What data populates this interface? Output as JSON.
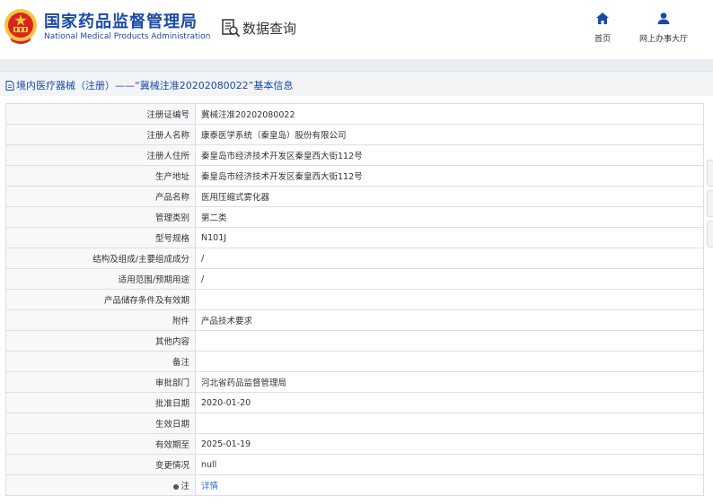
{
  "header": {
    "org_name_cn": "国家药品监督管理局",
    "org_name_en": "National Medical Products Administration",
    "query_title": "数据查询",
    "nav": [
      {
        "label": "首页",
        "icon": "home-icon"
      },
      {
        "label": "网上办事大厅",
        "icon": "user-icon"
      }
    ]
  },
  "breadcrumb": {
    "text": "境内医疗器械（注册）——“冀械注准20202080022”基本信息",
    "icon": "document-icon"
  },
  "rows": [
    {
      "label": "注册证编号",
      "value": "冀械注准20202080022"
    },
    {
      "label": "注册人名称",
      "value": "康泰医学系统（秦皇岛）股份有限公司"
    },
    {
      "label": "注册人住所",
      "value": "秦皇岛市经济技术开发区秦皇西大街112号"
    },
    {
      "label": "生产地址",
      "value": "秦皇岛市经济技术开发区秦皇西大街112号"
    },
    {
      "label": "产品名称",
      "value": "医用压缩式雾化器"
    },
    {
      "label": "管理类别",
      "value": "第二类"
    },
    {
      "label": "型号规格",
      "value": "N101J"
    },
    {
      "label": "结构及组成/主要组成成分",
      "value": "/"
    },
    {
      "label": "适用范围/预期用途",
      "value": "/"
    },
    {
      "label": "产品储存条件及有效期",
      "value": ""
    },
    {
      "label": "附件",
      "value": "产品技术要求"
    },
    {
      "label": "其他内容",
      "value": ""
    },
    {
      "label": "备注",
      "value": ""
    },
    {
      "label": "审批部门",
      "value": "河北省药品监督管理局"
    },
    {
      "label": "批准日期",
      "value": "2020-01-20"
    },
    {
      "label": "生效日期",
      "value": ""
    },
    {
      "label": "有效期至",
      "value": "2025-01-19"
    },
    {
      "label": "变更情况",
      "value": "null"
    },
    {
      "label": "注",
      "value": "详情"
    }
  ],
  "colors": {
    "brand_blue": "#1b4aa6",
    "link_blue": "#2a6fd1",
    "emblem_red": "#d7261e",
    "emblem_gold": "#f6c343"
  }
}
